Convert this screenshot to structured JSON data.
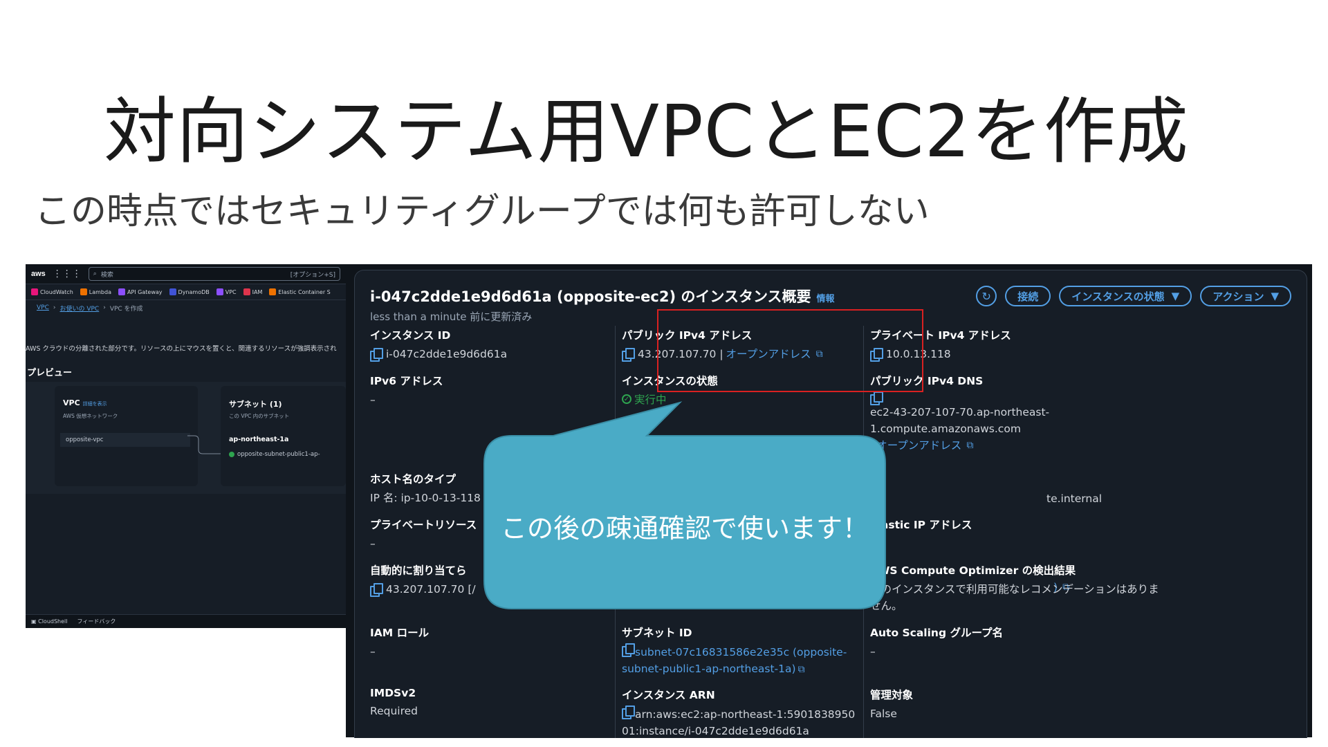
{
  "slide": {
    "title": "対向システム用VPCとEC2を作成",
    "subtitle": "この時点ではセキュリティグループでは何も許可しない"
  },
  "vpc_console": {
    "logo": "aws",
    "search_placeholder": "検索",
    "search_shortcut": "[オプション+S]",
    "favorites": [
      {
        "label": "CloudWatch",
        "color": "#e7157b"
      },
      {
        "label": "Lambda",
        "color": "#ed7100"
      },
      {
        "label": "API Gateway",
        "color": "#8c4fff"
      },
      {
        "label": "DynamoDB",
        "color": "#4053d6"
      },
      {
        "label": "VPC",
        "color": "#8c4fff"
      },
      {
        "label": "IAM",
        "color": "#dd344c"
      },
      {
        "label": "Elastic Container S",
        "color": "#ed7100"
      }
    ],
    "breadcrumbs": [
      "VPC",
      "お使いの VPC",
      "VPC を作成"
    ],
    "description": "AWS クラウドの分離された部分です。リソースの上にマウスを置くと、関連するリソースが強調表示され",
    "preview_label": "プレビュー",
    "vpc_box": {
      "title": "VPC",
      "more": "詳細を表示",
      "caption": "AWS 仮想ネットワーク",
      "item": "opposite-vpc"
    },
    "subnet_box": {
      "title": "サブネット (1)",
      "caption": "この VPC 内のサブネット",
      "az": "ap-northeast-1a",
      "item": "opposite-subnet-public1-ap-"
    },
    "footer": {
      "cloudshell": "CloudShell",
      "feedback": "フィードバック"
    }
  },
  "ec2": {
    "title": "i-047c2dde1e9d6d61a (opposite-ec2) のインスタンス概要",
    "info": "情報",
    "updated": "less than a minute 前に更新済み",
    "buttons": {
      "connect": "接続",
      "instance_state": "インスタンスの状態",
      "actions": "アクション"
    },
    "fields": {
      "instance_id": {
        "label": "インスタンス ID",
        "value": "i-047c2dde1e9d6d61a"
      },
      "public_ipv4": {
        "label": "パブリック IPv4 アドレス",
        "value": "43.207.107.70 |",
        "link": "オープンアドレス"
      },
      "private_ipv4": {
        "label": "プライベート IPv4 アドレス",
        "value": "10.0.13.118"
      },
      "ipv6": {
        "label": "IPv6 アドレス",
        "value": "–"
      },
      "instance_state": {
        "label": "インスタンスの状態",
        "value": "実行中"
      },
      "public_dns": {
        "label": "パブリック IPv4 DNS",
        "value": "ec2-43-207-107-70.ap-northeast-1.compute.amazonaws.com",
        "link": "オープンアドレス",
        "sep": "|"
      },
      "hostname_type": {
        "label": "ホスト名のタイプ",
        "value": "IP 名: ip-10-0-13-118"
      },
      "private_dns_suffix": {
        "value": "te.internal"
      },
      "private_resource": {
        "label": "プライベートリソース",
        "value": "–"
      },
      "elastic_ip": {
        "label": "Elastic IP アドレス",
        "value": "–"
      },
      "auto_assigned": {
        "label": "自動的に割り当てら",
        "value": "43.207.107.70 [/"
      },
      "vpc_id_tail": {
        "value": ")"
      },
      "compute_optimizer": {
        "label": "AWS Compute Optimizer の検出結果",
        "value": "このインスタンスで利用可能なレコメンデーションはありません。"
      },
      "iam_role": {
        "label": "IAM ロール",
        "value": "–"
      },
      "subnet_id": {
        "label": "サブネット ID",
        "value": "subnet-07c16831586e2e35c (opposite-subnet-public1-ap-northeast-1a)"
      },
      "asg_name": {
        "label": "Auto Scaling グループ名",
        "value": "–"
      },
      "imdsv2": {
        "label": "IMDSv2",
        "value": "Required"
      },
      "instance_arn": {
        "label": "インスタンス ARN",
        "value": "arn:aws:ec2:ap-northeast-1:590183895001:instance/i-047c2dde1e9d6d61a"
      },
      "managed": {
        "label": "管理対象",
        "value": "False"
      }
    }
  },
  "callout": {
    "text": "この後の疎通確認で使います！"
  }
}
